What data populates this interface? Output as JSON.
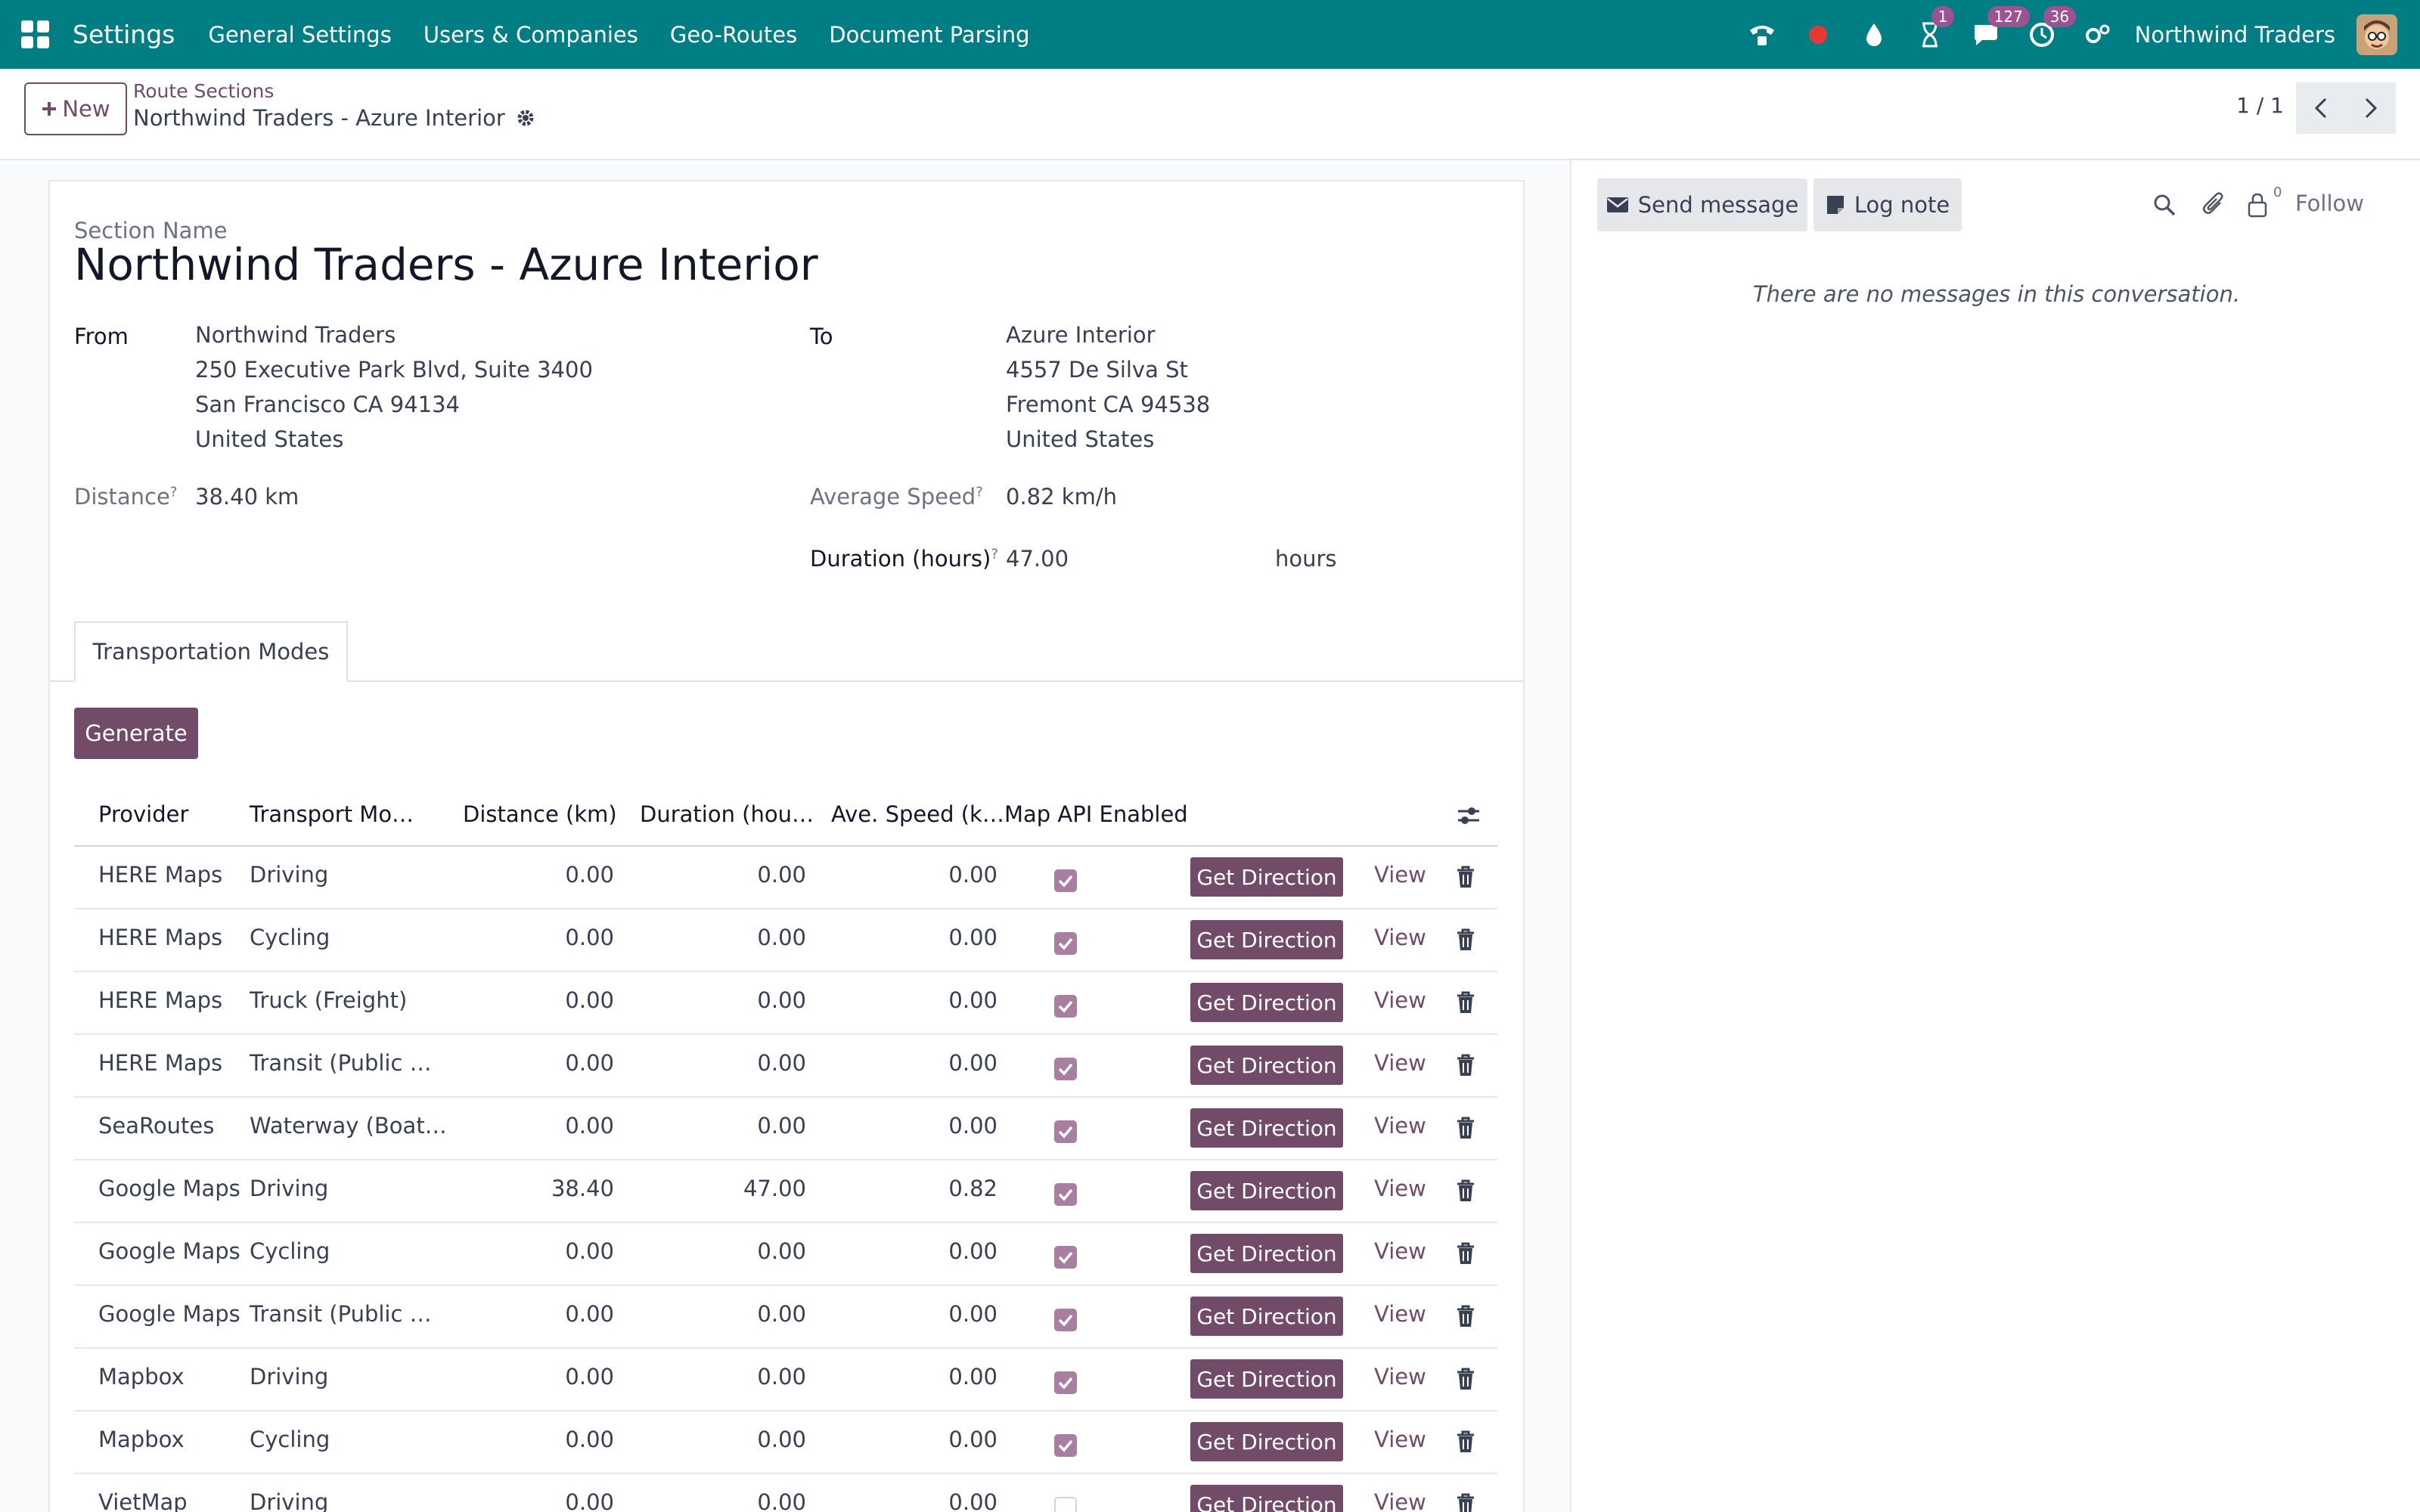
{
  "navbar": {
    "brand": "Settings",
    "menus": [
      "General Settings",
      "Users & Companies",
      "Geo-Routes",
      "Document Parsing"
    ],
    "activities_badge": "1",
    "messages_badge": "127",
    "timer_badge": "36",
    "company": "Northwind Traders",
    "accent": "#017e84"
  },
  "control": {
    "new_label": "New",
    "breadcrumb_parent": "Route Sections",
    "breadcrumb_current": "Northwind Traders - Azure Interior",
    "pager": "1 / 1"
  },
  "form": {
    "section_name_label": "Section Name",
    "section_name": "Northwind Traders - Azure Interior",
    "from_label": "From",
    "from_lines": [
      "Northwind Traders",
      "250 Executive Park Blvd, Suite 3400",
      "San Francisco CA 94134",
      "United States"
    ],
    "to_label": "To",
    "to_lines": [
      "Azure Interior",
      "4557 De Silva St",
      "Fremont CA 94538",
      "United States"
    ],
    "distance_label": "Distance",
    "distance": "38.40 km",
    "avg_speed_label": "Average Speed",
    "avg_speed": "0.82 km/h",
    "duration_label": "Duration (hours)",
    "duration": "47.00",
    "duration_unit": "hours",
    "help_mark": "?"
  },
  "tabs": {
    "transport": "Transportation Modes"
  },
  "table": {
    "generate_label": "Generate",
    "headers": {
      "provider": "Provider",
      "mode": "Transport Mo…",
      "distance": "Distance (km)",
      "duration": "Duration (hou…",
      "speed": "Ave. Speed (k…",
      "map_api": "Map API Enabled"
    },
    "action_label": "Get Direction",
    "view_label": "View",
    "rows": [
      {
        "provider": "HERE Maps",
        "mode": "Driving",
        "distance": "0.00",
        "duration": "0.00",
        "speed": "0.00",
        "api": true
      },
      {
        "provider": "HERE Maps",
        "mode": "Cycling",
        "distance": "0.00",
        "duration": "0.00",
        "speed": "0.00",
        "api": true
      },
      {
        "provider": "HERE Maps",
        "mode": "Truck (Freight)",
        "distance": "0.00",
        "duration": "0.00",
        "speed": "0.00",
        "api": true
      },
      {
        "provider": "HERE Maps",
        "mode": "Transit (Public …",
        "distance": "0.00",
        "duration": "0.00",
        "speed": "0.00",
        "api": true
      },
      {
        "provider": "SeaRoutes",
        "mode": "Waterway (Boat…",
        "distance": "0.00",
        "duration": "0.00",
        "speed": "0.00",
        "api": true
      },
      {
        "provider": "Google Maps",
        "mode": "Driving",
        "distance": "38.40",
        "duration": "47.00",
        "speed": "0.82",
        "api": true
      },
      {
        "provider": "Google Maps",
        "mode": "Cycling",
        "distance": "0.00",
        "duration": "0.00",
        "speed": "0.00",
        "api": true
      },
      {
        "provider": "Google Maps",
        "mode": "Transit (Public …",
        "distance": "0.00",
        "duration": "0.00",
        "speed": "0.00",
        "api": true
      },
      {
        "provider": "Mapbox",
        "mode": "Driving",
        "distance": "0.00",
        "duration": "0.00",
        "speed": "0.00",
        "api": true
      },
      {
        "provider": "Mapbox",
        "mode": "Cycling",
        "distance": "0.00",
        "duration": "0.00",
        "speed": "0.00",
        "api": true
      },
      {
        "provider": "VietMap",
        "mode": "Driving",
        "distance": "0.00",
        "duration": "0.00",
        "speed": "0.00",
        "api": false
      }
    ]
  },
  "chatter": {
    "send_message": "Send message",
    "log_note": "Log note",
    "followers_count": "0",
    "follow": "Follow",
    "empty": "There are no messages in this conversation."
  }
}
